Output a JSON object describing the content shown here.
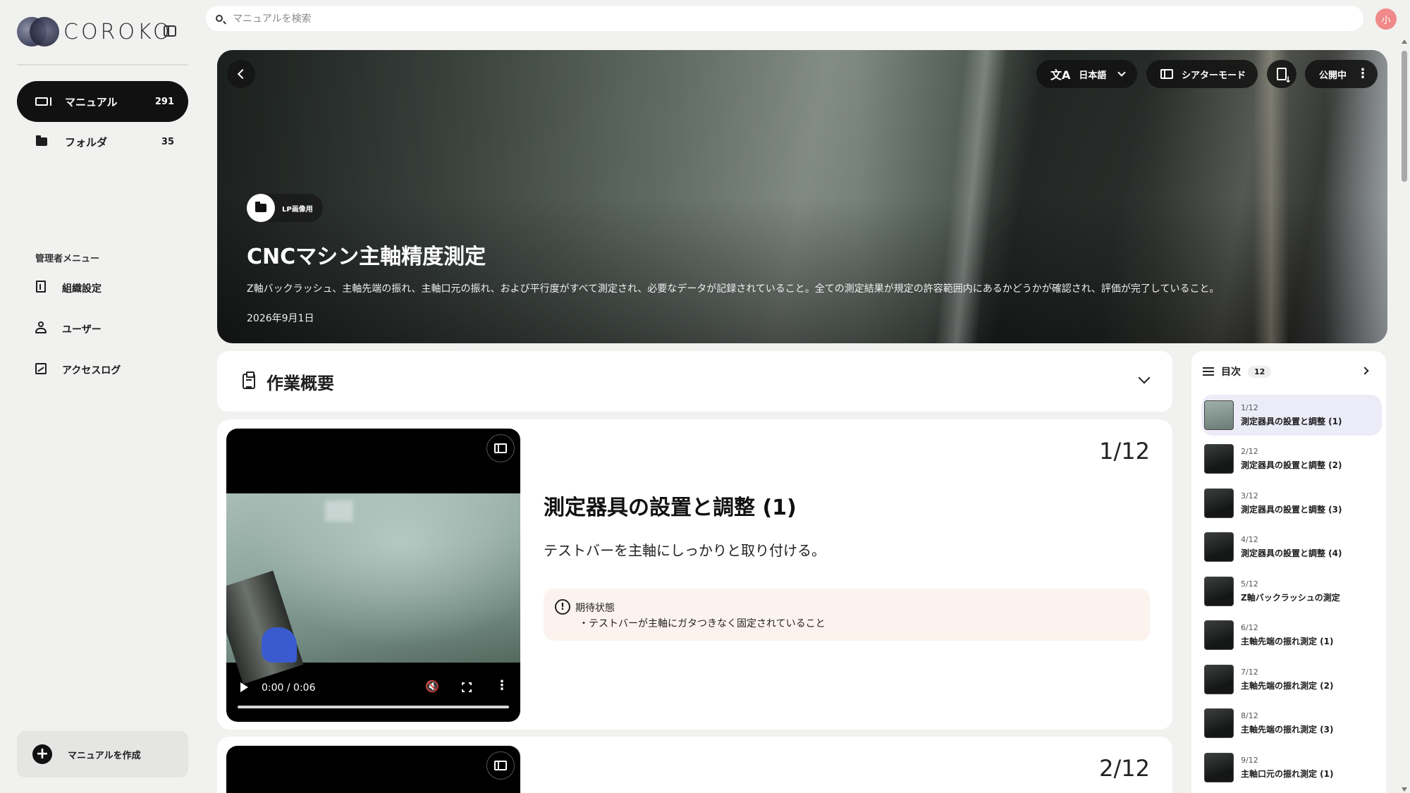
{
  "app": {
    "logo_text": "COROKO"
  },
  "search": {
    "placeholder": "マニュアルを検索"
  },
  "user": {
    "avatar_initial": "小",
    "avatar_color": "#f08a8a"
  },
  "sidebar": {
    "nav": [
      {
        "label": "マニュアル",
        "count": "291",
        "icon": "manual-icon",
        "active": true
      },
      {
        "label": "フォルダ",
        "count": "35",
        "icon": "folder-icon",
        "active": false
      }
    ],
    "admin_title": "管理者メニュー",
    "admin_items": [
      {
        "label": "組織設定",
        "icon": "building-icon"
      },
      {
        "label": "ユーザー",
        "icon": "user-icon"
      },
      {
        "label": "アクセスログ",
        "icon": "chart-icon"
      }
    ],
    "create_button": "マニュアルを作成"
  },
  "hero": {
    "language": "日本語",
    "theater_mode": "シアターモード",
    "status": "公開中",
    "folder_name": "LP画像用",
    "title": "CNCマシン主軸精度測定",
    "description": "Z軸バックラッシュ、主軸先端の振れ、主軸口元の振れ、および平行度がすべて測定され、必要なデータが記録されていること。全ての測定結果が規定の許容範囲内にあるかどうかが確認され、評価が完了していること。",
    "date": "2026年9月1日"
  },
  "overview": {
    "title": "作業概要"
  },
  "steps": [
    {
      "number": "1/12",
      "title": "測定器具の設置と調整 (1)",
      "text": "テストバーを主軸にしっかりと取り付ける。",
      "expected_heading": "期待状態",
      "expected_item": "・テストバーが主軸にガタつきなく固定されていること",
      "video_time": "0:00 / 0:06"
    },
    {
      "number": "2/12"
    }
  ],
  "toc": {
    "title": "目次",
    "count": "12",
    "items": [
      {
        "index": "1/12",
        "title": "測定器具の設置と調整 (1)",
        "active": true
      },
      {
        "index": "2/12",
        "title": "測定器具の設置と調整 (2)",
        "active": false
      },
      {
        "index": "3/12",
        "title": "測定器具の設置と調整 (3)",
        "active": false
      },
      {
        "index": "4/12",
        "title": "測定器具の設置と調整 (4)",
        "active": false
      },
      {
        "index": "5/12",
        "title": "Z軸バックラッシュの測定",
        "active": false
      },
      {
        "index": "6/12",
        "title": "主軸先端の振れ測定 (1)",
        "active": false
      },
      {
        "index": "7/12",
        "title": "主軸先端の振れ測定 (2)",
        "active": false
      },
      {
        "index": "8/12",
        "title": "主軸先端の振れ測定 (3)",
        "active": false
      },
      {
        "index": "9/12",
        "title": "主軸口元の振れ測定 (1)",
        "active": false
      }
    ]
  }
}
